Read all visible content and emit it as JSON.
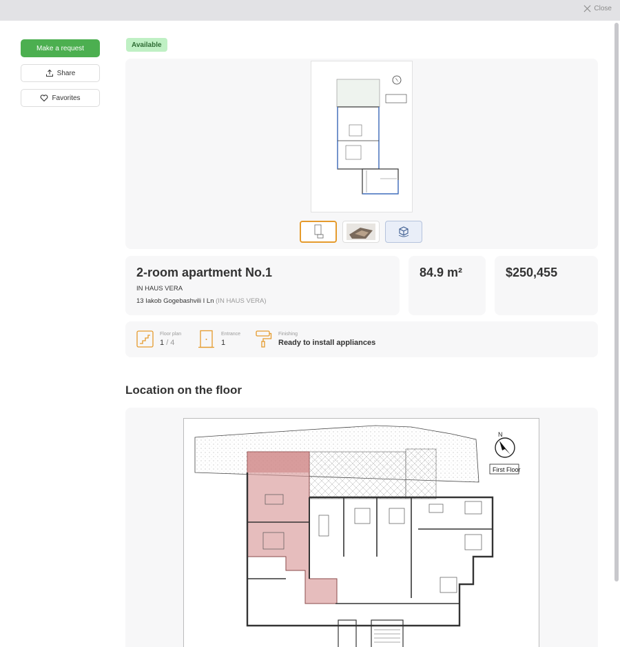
{
  "topbar": {
    "close_label": "Close"
  },
  "actions": {
    "request_label": "Make a request",
    "share_label": "Share",
    "favorites_label": "Favorites"
  },
  "status": {
    "label": "Available",
    "color": "#bff0c4"
  },
  "gallery": {
    "thumbnails": [
      "plan-thumbnail",
      "render-thumbnail",
      "3d-model-icon"
    ],
    "active_index": 0
  },
  "apartment": {
    "title": "2-room apartment No.1",
    "complex": "IN HAUS VERA",
    "address": "13 Iakob Gogebashvili I Ln",
    "address_note": "(IN HAUS VERA)",
    "area": "84.9 m²",
    "price": "$250,455"
  },
  "specs": {
    "floor_label": "Floor plan",
    "floor_current": "1",
    "floor_total": "/ 4",
    "entrance_label": "Entrance",
    "entrance_value": "1",
    "finishing_label": "Finishing",
    "finishing_value": "Ready to install appliances"
  },
  "location": {
    "title": "Location on the floor",
    "floor_name": "First Floor",
    "compass_letter": "N"
  },
  "colors": {
    "accent_green": "#4caf50",
    "accent_orange": "#e59a2b",
    "highlight": "#c98a8a"
  }
}
